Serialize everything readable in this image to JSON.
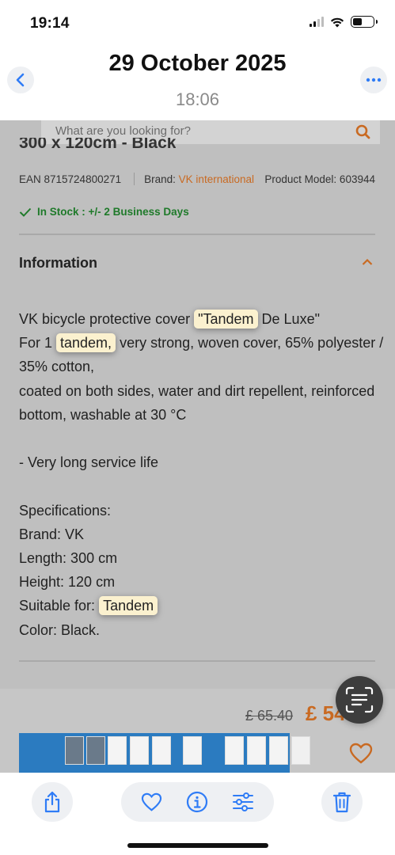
{
  "status_bar": {
    "time": "19:14"
  },
  "header": {
    "date": "29 October 2025",
    "time": "18:06"
  },
  "screenshot": {
    "search_placeholder": "What are you looking for?",
    "cut_title": "300 x 120cm - Black",
    "ean": "EAN 8715724800271",
    "brand_label": "Brand:",
    "brand_value": "VK international",
    "model": "Product Model: 603944",
    "stock": "In Stock : +/- 2 Business Days",
    "info_title": "Information",
    "desc": {
      "l1_a": "VK bicycle protective cover ",
      "l1_hl": "\"Tandem",
      "l1_b": " De Luxe\"",
      "l2_a": "For 1 ",
      "l2_hl": "tandem,",
      "l2_b": " very strong, woven cover, 65% polyester /",
      "l3": "35% cotton,",
      "l4": "coated on both sides, water and dirt repellent, reinforced",
      "l5": "bottom, washable at 30 °C",
      "l6": "- Very long service life",
      "l7": "Specifications:",
      "l8": "Brand: VK",
      "l9": "Length: 300 cm",
      "l10": "Height: 120 cm",
      "l11_a": "Suitable for: ",
      "l11_hl": "Tandem",
      "l12": "Color: Black."
    },
    "old_price": "£ 65.40",
    "new_price": "£ 54"
  },
  "toolbar": {
    "share": "share-icon",
    "favorite": "heart-icon",
    "info": "info-icon",
    "adjust": "sliders-icon",
    "delete": "trash-icon"
  },
  "colors": {
    "accent": "#2f7cf6",
    "brand_orange": "#c96a22",
    "stock_green": "#1f7a2a"
  }
}
